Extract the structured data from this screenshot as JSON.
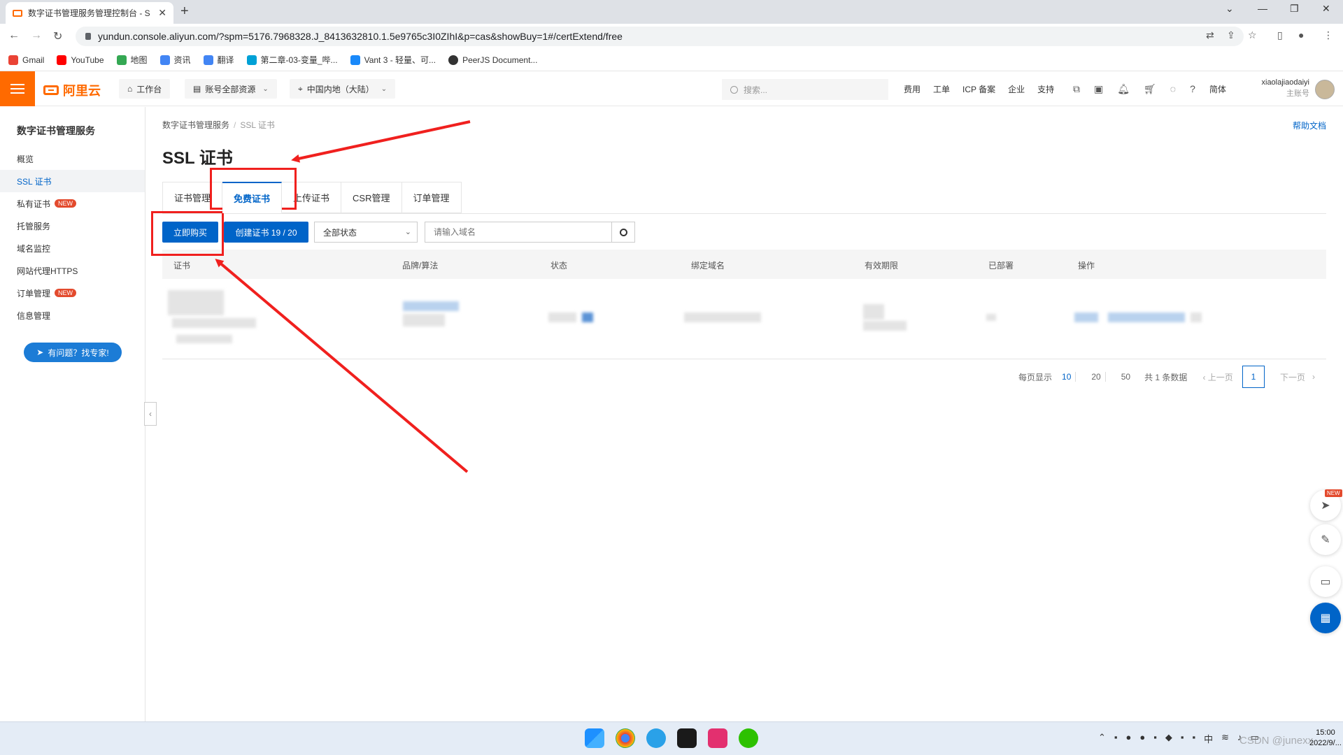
{
  "browser": {
    "tab_title": "数字证书管理服务管理控制台 - S",
    "tab_close": "✕",
    "new_tab": "+",
    "url": "yundun.console.aliyun.com/?spm=5176.7968328.J_8413632810.1.5e9765c3I0ZIhI&p=cas&showBuy=1#/certExtend/free",
    "bookmarks": [
      {
        "label": "Gmail",
        "color": "#ea4335"
      },
      {
        "label": "YouTube",
        "color": "#ff0000"
      },
      {
        "label": "地图",
        "color": "#34a853"
      },
      {
        "label": "资讯",
        "color": "#4285f4"
      },
      {
        "label": "翻译",
        "color": "#4285f4"
      },
      {
        "label": "第二章-03-变量_哔...",
        "color": "#00a1d6"
      },
      {
        "label": "Vant 3 - 轻量、可...",
        "color": "#1989fa"
      },
      {
        "label": "PeerJS Document...",
        "color": "#333333"
      }
    ]
  },
  "console": {
    "logo": "阿里云",
    "workbench": "工作台",
    "resources": "账号全部资源",
    "region": "中国内地（大陆）",
    "search_placeholder": "搜索...",
    "links": [
      "费用",
      "工单",
      "ICP 备案",
      "企业",
      "支持"
    ],
    "lang": "简体",
    "username": "xiaolajiaodaiyi",
    "user_role": "主账号"
  },
  "sidebar": {
    "title": "数字证书管理服务",
    "items": [
      {
        "label": "概览",
        "new": false
      },
      {
        "label": "SSL 证书",
        "new": false,
        "active": true
      },
      {
        "label": "私有证书",
        "new": true
      },
      {
        "label": "托管服务",
        "new": false
      },
      {
        "label": "域名监控",
        "new": false
      },
      {
        "label": "网站代理HTTPS",
        "new": false
      },
      {
        "label": "订单管理",
        "new": true
      },
      {
        "label": "信息管理",
        "new": false
      }
    ],
    "new_badge": "NEW",
    "help_button": "有问题？找专家!"
  },
  "main": {
    "breadcrumb": [
      "数字证书管理服务",
      "SSL 证书"
    ],
    "help_doc": "帮助文档",
    "title": "SSL 证书",
    "tabs": [
      "证书管理",
      "免费证书",
      "上传证书",
      "CSR管理",
      "订单管理"
    ],
    "buy_button": "立即购买",
    "create_button": "创建证书 19 / 20",
    "status_select": "全部状态",
    "domain_placeholder": "请输入域名",
    "columns": [
      "证书",
      "品牌/算法",
      "状态",
      "绑定域名",
      "有效期限",
      "已部署",
      "操作"
    ],
    "pagination": {
      "per_page_label": "每页显示",
      "sizes": [
        "10",
        "20",
        "50"
      ],
      "total": "共 1 条数据",
      "prev": "上一页",
      "next": "下一页",
      "current_page": "1"
    }
  },
  "taskbar": {
    "ime": "中",
    "time": "15:00",
    "date": "2022/9/..."
  },
  "watermark": "CSDN @junexx",
  "colors": {
    "brand_orange": "#ff6a00",
    "primary_blue": "#0064c8",
    "annotation_red": "#f0201e"
  }
}
